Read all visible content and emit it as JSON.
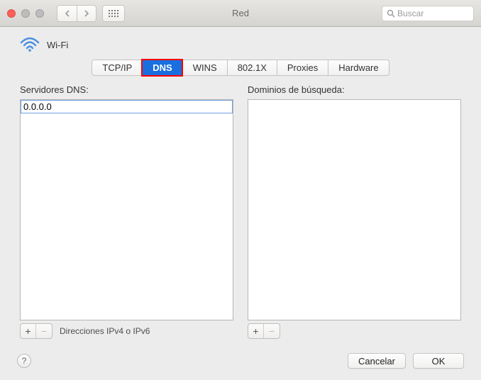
{
  "window": {
    "title": "Red",
    "search_placeholder": "Buscar"
  },
  "wifi": {
    "label": "Wi-Fi"
  },
  "tabs": {
    "tcpip": "TCP/IP",
    "dns": "DNS",
    "wins": "WINS",
    "dot1x": "802.1X",
    "proxies": "Proxies",
    "hardware": "Hardware"
  },
  "dns": {
    "servers_label": "Servidores DNS:",
    "servers": [
      {
        "value": "0.0.0.0",
        "editing": true
      }
    ],
    "search_domains_label": "Dominios de búsqueda:",
    "hint": "Direcciones IPv4 o IPv6"
  },
  "buttons": {
    "cancel": "Cancelar",
    "ok": "OK",
    "help": "?"
  }
}
